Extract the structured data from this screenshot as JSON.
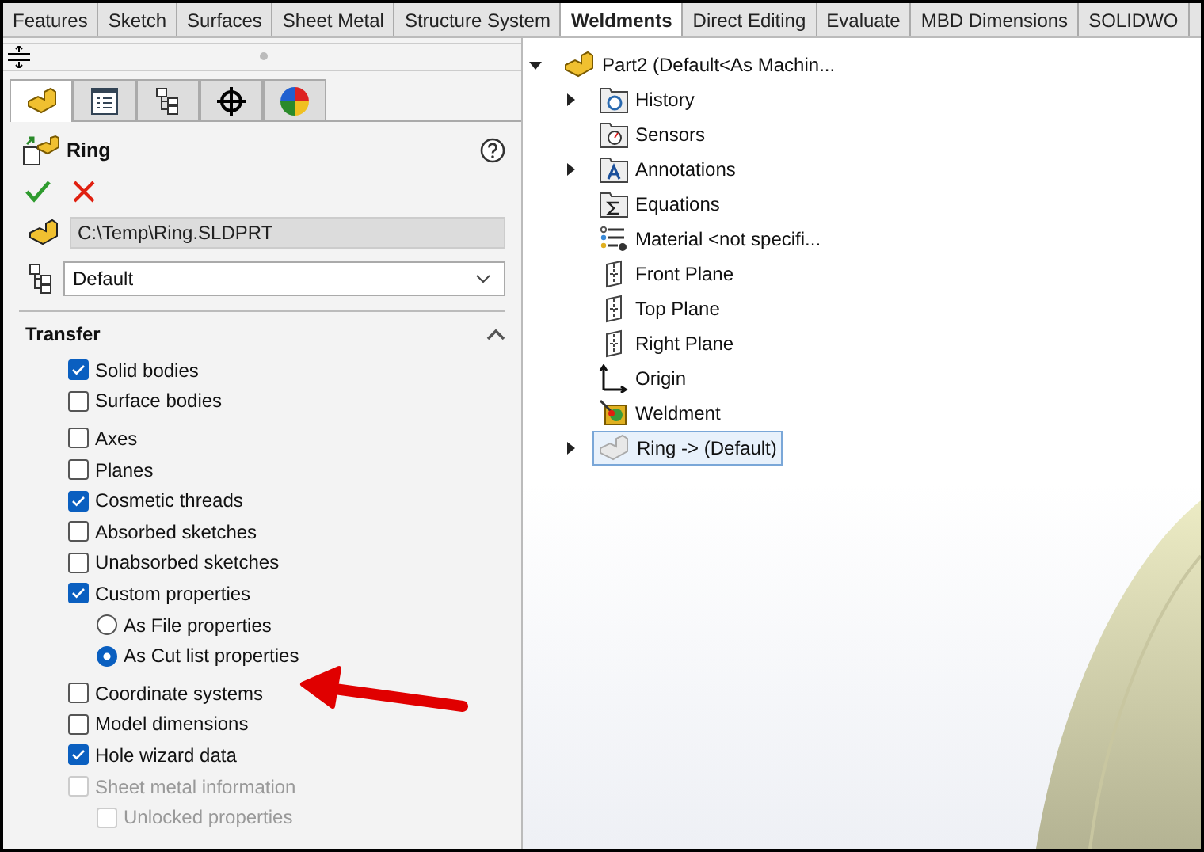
{
  "command_tabs": [
    {
      "label": "Features",
      "selected": false
    },
    {
      "label": "Sketch",
      "selected": false
    },
    {
      "label": "Surfaces",
      "selected": false
    },
    {
      "label": "Sheet Metal",
      "selected": false
    },
    {
      "label": "Structure System",
      "selected": false
    },
    {
      "label": "Weldments",
      "selected": true
    },
    {
      "label": "Direct Editing",
      "selected": false
    },
    {
      "label": "Evaluate",
      "selected": false
    },
    {
      "label": "MBD Dimensions",
      "selected": false
    },
    {
      "label": "SOLIDWO",
      "selected": false
    }
  ],
  "panel": {
    "tabs": [
      {
        "kind": "feature",
        "selected": true
      },
      {
        "kind": "property",
        "selected": false
      },
      {
        "kind": "configuration",
        "selected": false
      },
      {
        "kind": "target",
        "selected": false
      },
      {
        "kind": "appearance",
        "selected": false
      }
    ],
    "title": "Ring",
    "file_path": "C:\\Temp\\Ring.SLDPRT",
    "configuration": "Default",
    "section": {
      "title": "Transfer",
      "expanded": true
    },
    "option_groups": [
      [
        {
          "kind": "checkbox",
          "label": "Solid bodies",
          "checked": true,
          "disabled": false
        },
        {
          "kind": "checkbox",
          "label": "Surface bodies",
          "checked": false,
          "disabled": false
        }
      ],
      [
        {
          "kind": "checkbox",
          "label": "Axes",
          "checked": false,
          "disabled": false
        },
        {
          "kind": "checkbox",
          "label": "Planes",
          "checked": false,
          "disabled": false
        },
        {
          "kind": "checkbox",
          "label": "Cosmetic threads",
          "checked": true,
          "disabled": false
        },
        {
          "kind": "checkbox",
          "label": "Absorbed sketches",
          "checked": false,
          "disabled": false
        },
        {
          "kind": "checkbox",
          "label": "Unabsorbed sketches",
          "checked": false,
          "disabled": false
        },
        {
          "kind": "checkbox",
          "label": "Custom properties",
          "checked": true,
          "disabled": false,
          "children": [
            {
              "kind": "radio",
              "label": "As File properties",
              "selected": false,
              "disabled": false
            },
            {
              "kind": "radio",
              "label": "As Cut list properties",
              "selected": true,
              "disabled": false
            }
          ]
        }
      ],
      [
        {
          "kind": "checkbox",
          "label": "Coordinate systems",
          "checked": false,
          "disabled": false
        },
        {
          "kind": "checkbox",
          "label": "Model dimensions",
          "checked": false,
          "disabled": false
        },
        {
          "kind": "checkbox",
          "label": "Hole wizard data",
          "checked": true,
          "disabled": false
        },
        {
          "kind": "checkbox",
          "label": "Sheet metal information",
          "checked": false,
          "disabled": true,
          "children": [
            {
              "kind": "checkbox",
              "label": "Unlocked properties",
              "checked": false,
              "disabled": true
            }
          ]
        }
      ]
    ]
  },
  "tree": {
    "root": {
      "kind": "part",
      "label": "Part2 (Default<As Machin...",
      "has_children": true,
      "expanded": true,
      "selected": false,
      "children": [
        {
          "kind": "history",
          "label": "History",
          "has_children": true,
          "expanded": false,
          "selected": false
        },
        {
          "kind": "sensors",
          "label": "Sensors",
          "has_children": false,
          "expanded": false,
          "selected": false
        },
        {
          "kind": "annotations",
          "label": "Annotations",
          "has_children": true,
          "expanded": false,
          "selected": false
        },
        {
          "kind": "equations",
          "label": "Equations",
          "has_children": false,
          "expanded": false,
          "selected": false
        },
        {
          "kind": "material",
          "label": "Material <not specifi...",
          "has_children": false,
          "expanded": false,
          "selected": false
        },
        {
          "kind": "plane",
          "label": "Front Plane",
          "has_children": false,
          "expanded": false,
          "selected": false
        },
        {
          "kind": "plane",
          "label": "Top Plane",
          "has_children": false,
          "expanded": false,
          "selected": false
        },
        {
          "kind": "plane",
          "label": "Right Plane",
          "has_children": false,
          "expanded": false,
          "selected": false
        },
        {
          "kind": "origin",
          "label": "Origin",
          "has_children": false,
          "expanded": false,
          "selected": false
        },
        {
          "kind": "weldment",
          "label": "Weldment",
          "has_children": false,
          "expanded": false,
          "selected": false
        },
        {
          "kind": "derived-part",
          "label": "Ring -> (Default)",
          "has_children": true,
          "expanded": false,
          "selected": true
        }
      ]
    }
  }
}
